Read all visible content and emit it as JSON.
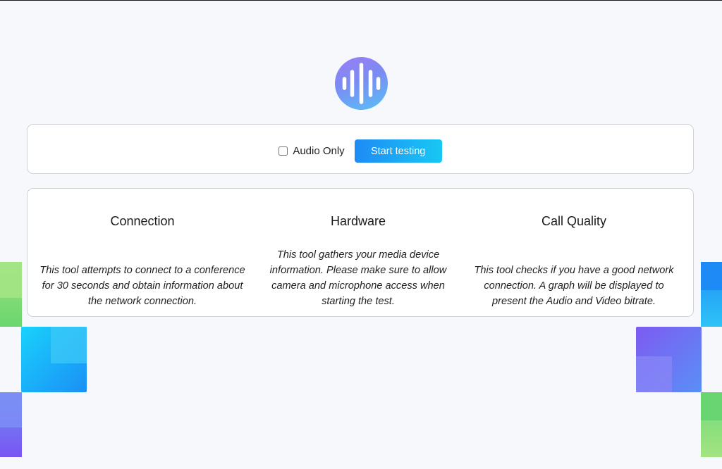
{
  "logo": {
    "icon": "sound-wave-icon"
  },
  "controls": {
    "audio_only_label": "Audio Only",
    "audio_only_checked": false,
    "start_button_label": "Start testing"
  },
  "sections": [
    {
      "title": "Connection",
      "description": "This tool attempts to connect to a conference for 30 seconds and obtain information about the network connection."
    },
    {
      "title": "Hardware",
      "description": "This tool gathers your media device information. Please make sure to allow camera and microphone access when starting the test."
    },
    {
      "title": "Call Quality",
      "description": "This tool checks if you have a good network connection. A graph will be displayed to present the Audio and Video bitrate."
    }
  ],
  "colors": {
    "accent_start": "#1e8bf5",
    "accent_end": "#18c8f3",
    "logo_top": "#9b7cf4",
    "logo_bottom": "#58c1f5",
    "page_bg": "#f7f8fc"
  }
}
